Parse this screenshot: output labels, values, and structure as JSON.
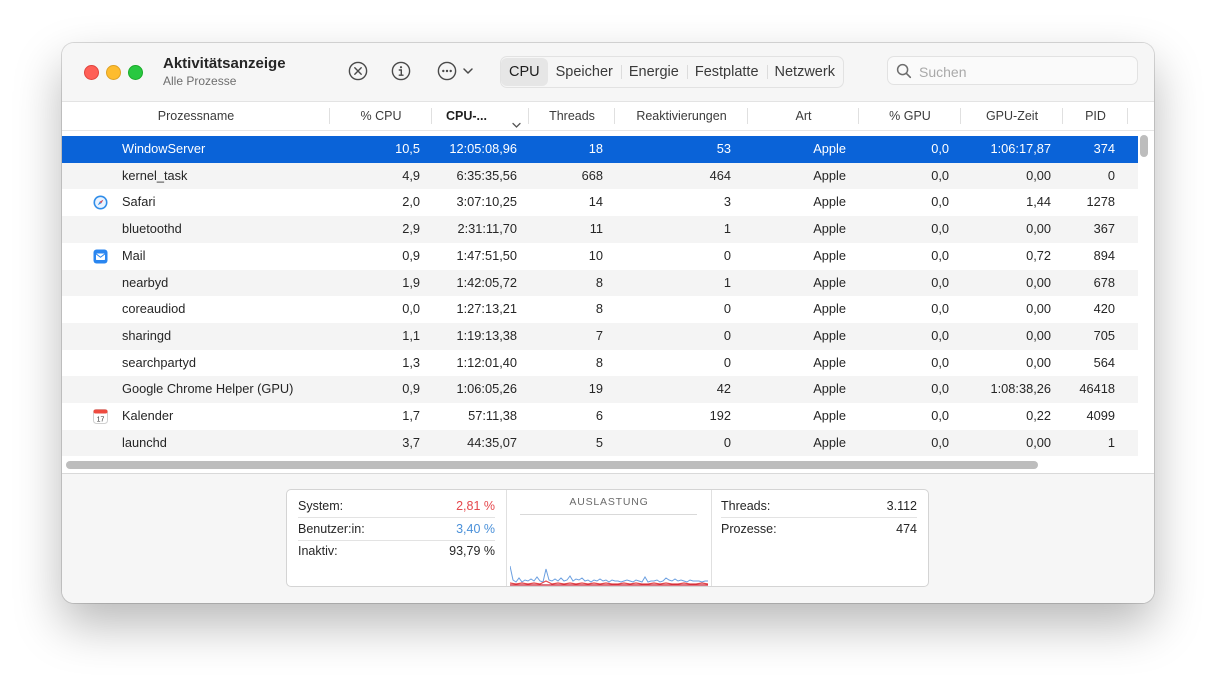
{
  "app": {
    "title": "Aktivitätsanzeige",
    "subtitle": "Alle Prozesse"
  },
  "toolbar": {
    "tabs": [
      {
        "label": "CPU",
        "active": true
      },
      {
        "label": "Speicher"
      },
      {
        "label": "Energie"
      },
      {
        "label": "Festplatte"
      },
      {
        "label": "Netzwerk"
      }
    ],
    "search_placeholder": "Suchen",
    "icons": [
      "stop-process-icon",
      "info-icon",
      "more-options-icon",
      "chevron-down-icon",
      "search-icon"
    ]
  },
  "table": {
    "headers": {
      "name": "Prozessname",
      "cpu": "% CPU",
      "cputime": "CPU-...",
      "threads": "Threads",
      "react": "Reaktivierungen",
      "art": "Art",
      "gpu": "% GPU",
      "gputime": "GPU-Zeit",
      "pid": "PID"
    },
    "rows": [
      {
        "name": "WindowServer",
        "icon": "",
        "cpu": "10,5",
        "cputime": "12:05:08,96",
        "threads": "18",
        "react": "53",
        "art": "Apple",
        "gpu": "0,0",
        "gputime": "1:06:17,87",
        "pid": "374",
        "selected": true
      },
      {
        "name": "kernel_task",
        "icon": "",
        "cpu": "4,9",
        "cputime": "6:35:35,56",
        "threads": "668",
        "react": "464",
        "art": "Apple",
        "gpu": "0,0",
        "gputime": "0,00",
        "pid": "0"
      },
      {
        "name": "Safari",
        "icon": "safari-icon",
        "cpu": "2,0",
        "cputime": "3:07:10,25",
        "threads": "14",
        "react": "3",
        "art": "Apple",
        "gpu": "0,0",
        "gputime": "1,44",
        "pid": "1278"
      },
      {
        "name": "bluetoothd",
        "icon": "",
        "cpu": "2,9",
        "cputime": "2:31:11,70",
        "threads": "11",
        "react": "1",
        "art": "Apple",
        "gpu": "0,0",
        "gputime": "0,00",
        "pid": "367"
      },
      {
        "name": "Mail",
        "icon": "mail-icon",
        "cpu": "0,9",
        "cputime": "1:47:51,50",
        "threads": "10",
        "react": "0",
        "art": "Apple",
        "gpu": "0,0",
        "gputime": "0,72",
        "pid": "894"
      },
      {
        "name": "nearbyd",
        "icon": "",
        "cpu": "1,9",
        "cputime": "1:42:05,72",
        "threads": "8",
        "react": "1",
        "art": "Apple",
        "gpu": "0,0",
        "gputime": "0,00",
        "pid": "678"
      },
      {
        "name": "coreaudiod",
        "icon": "",
        "cpu": "0,0",
        "cputime": "1:27:13,21",
        "threads": "8",
        "react": "0",
        "art": "Apple",
        "gpu": "0,0",
        "gputime": "0,00",
        "pid": "420"
      },
      {
        "name": "sharingd",
        "icon": "",
        "cpu": "1,1",
        "cputime": "1:19:13,38",
        "threads": "7",
        "react": "0",
        "art": "Apple",
        "gpu": "0,0",
        "gputime": "0,00",
        "pid": "705"
      },
      {
        "name": "searchpartyd",
        "icon": "",
        "cpu": "1,3",
        "cputime": "1:12:01,40",
        "threads": "8",
        "react": "0",
        "art": "Apple",
        "gpu": "0,0",
        "gputime": "0,00",
        "pid": "564"
      },
      {
        "name": "Google Chrome Helper (GPU)",
        "icon": "",
        "cpu": "0,9",
        "cputime": "1:06:05,26",
        "threads": "19",
        "react": "42",
        "art": "Apple",
        "gpu": "0,0",
        "gputime": "1:08:38,26",
        "pid": "46418"
      },
      {
        "name": "Kalender",
        "icon": "calendar-icon",
        "icon_text": "17",
        "cpu": "1,7",
        "cputime": "57:11,38",
        "threads": "6",
        "react": "192",
        "art": "Apple",
        "gpu": "0,0",
        "gputime": "0,22",
        "pid": "4099"
      },
      {
        "name": "launchd",
        "icon": "",
        "cpu": "3,7",
        "cputime": "44:35,07",
        "threads": "5",
        "react": "0",
        "art": "Apple",
        "gpu": "0,0",
        "gputime": "0,00",
        "pid": "1"
      }
    ]
  },
  "stats": {
    "system": {
      "label": "System:",
      "value": "2,81 %",
      "color": "#e5484d"
    },
    "user": {
      "label": "Benutzer:in:",
      "value": "3,40 %",
      "color": "#4a90d9"
    },
    "idle": {
      "label": "Inaktiv:",
      "value": "93,79 %"
    },
    "chart_title": "AUSLASTUNG",
    "threads": {
      "label": "Threads:",
      "value": "3.112"
    },
    "processes": {
      "label": "Prozesse:",
      "value": "474"
    }
  },
  "colors": {
    "selection": "#0a63d8",
    "system": "#e5484d",
    "user": "#4a90d9"
  }
}
